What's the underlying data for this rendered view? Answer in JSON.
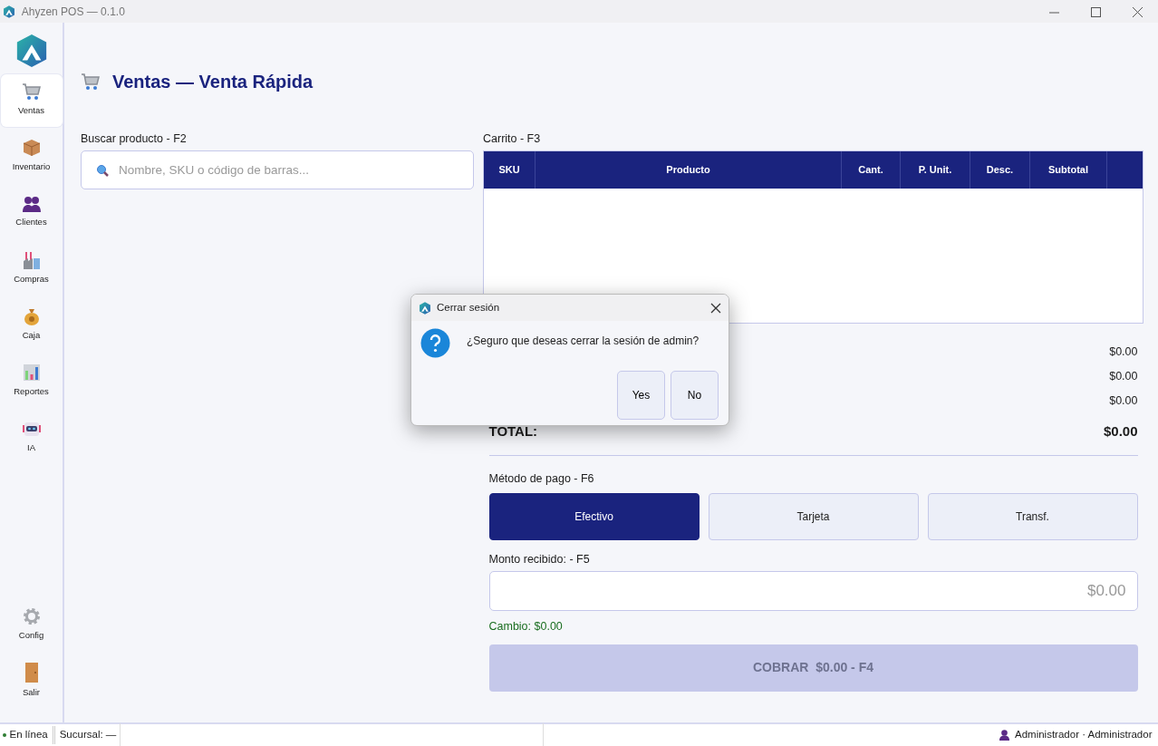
{
  "window": {
    "title": "Ahyzen POS — 0.1.0"
  },
  "sidebar": {
    "items": [
      {
        "label": "Ventas",
        "selected": true
      },
      {
        "label": "Inventario",
        "selected": false
      },
      {
        "label": "Clientes",
        "selected": false
      },
      {
        "label": "Compras",
        "selected": false
      },
      {
        "label": "Caja",
        "selected": false
      },
      {
        "label": "Reportes",
        "selected": false
      },
      {
        "label": "IA",
        "selected": false
      }
    ],
    "bottom_items": [
      {
        "label": "Config",
        "selected": false
      },
      {
        "label": "Salir",
        "selected": false
      }
    ]
  },
  "page": {
    "title": "Ventas — Venta Rápida"
  },
  "search": {
    "label": "Buscar producto - F2",
    "placeholder": "Nombre, SKU o código de barras..."
  },
  "cart": {
    "label": "Carrito - F3",
    "columns": [
      "SKU",
      "Producto",
      "Cant.",
      "P. Unit.",
      "Desc.",
      "Subtotal"
    ]
  },
  "totals": {
    "values": [
      "$0.00",
      "$0.00",
      "$0.00"
    ],
    "total_label": "TOTAL:",
    "total_value": "$0.00"
  },
  "payment": {
    "label": "Método de pago - F6",
    "methods": [
      {
        "label": "Efectivo",
        "selected": true
      },
      {
        "label": "Tarjeta",
        "selected": false
      },
      {
        "label": "Transf.",
        "selected": false
      }
    ]
  },
  "amount": {
    "label": "Monto recibido: - F5",
    "placeholder": "$0.00"
  },
  "change": {
    "text": "Cambio: $0.00"
  },
  "charge_button": {
    "label": "COBRAR  $0.00 - F4",
    "disabled": true
  },
  "status_bar": {
    "online": true,
    "connection": "En línea",
    "branch": "Sucursal: —",
    "user": "Administrador · Administrador"
  },
  "dialog": {
    "title": "Cerrar sesión",
    "message": "¿Seguro que deseas cerrar la sesión de admin?",
    "buttons": [
      "Yes",
      "No"
    ]
  }
}
